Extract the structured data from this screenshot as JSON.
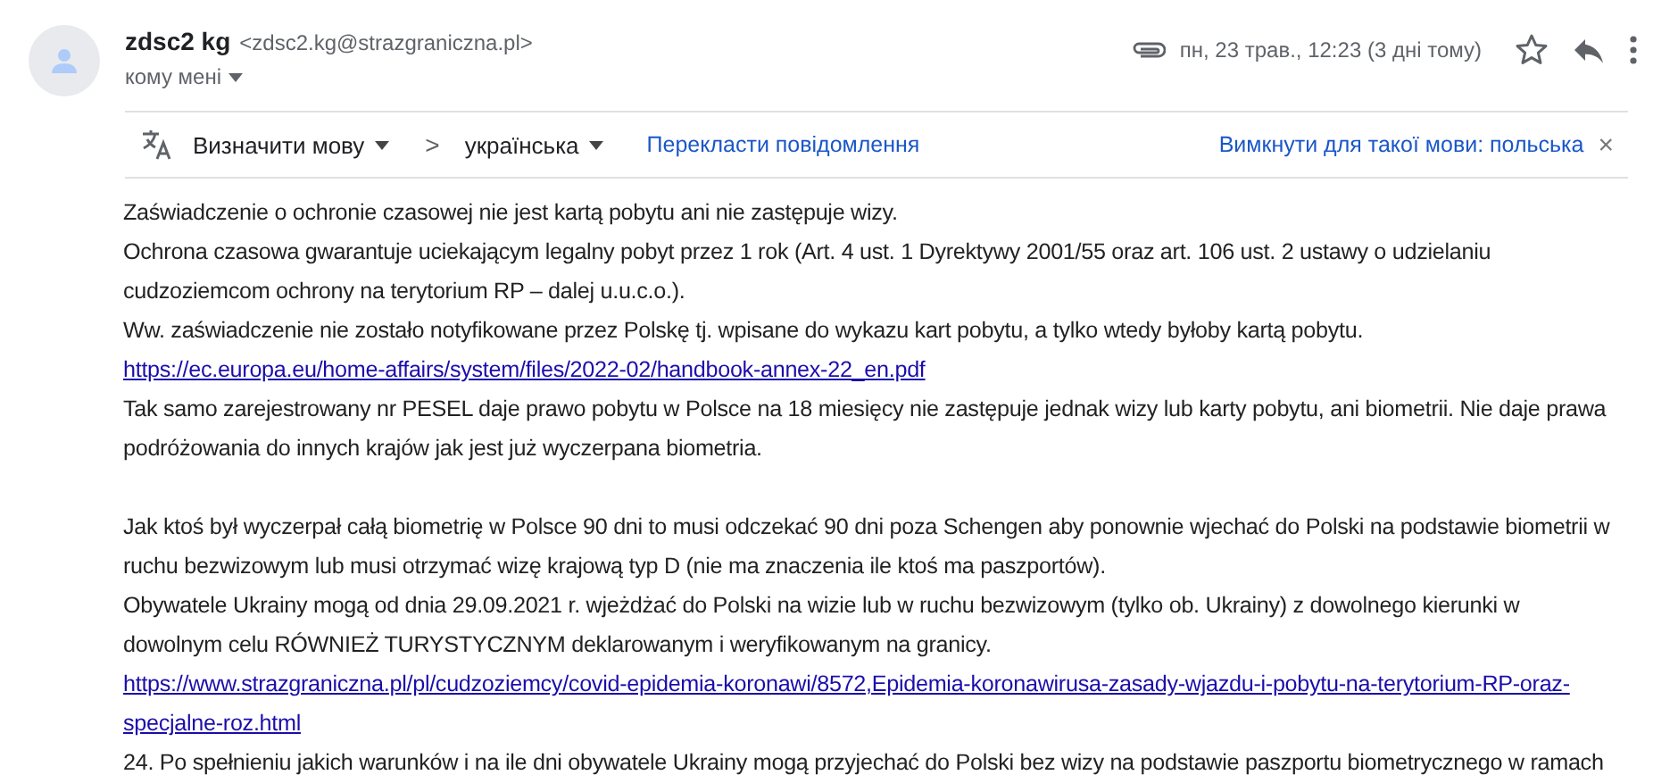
{
  "sender": {
    "name": "zdsc2 kg",
    "email": "<zdsc2.kg@strazgraniczna.pl>",
    "recipient": "кому мені"
  },
  "meta": {
    "date": "пн, 23 трав., 12:23 (3 дні тому)"
  },
  "translate_bar": {
    "source_language": "Визначити мову",
    "separator": ">",
    "target_language": "українська",
    "translate_link": "Перекласти повідомлення",
    "disable_link": "Вимкнути для такої мови: польська",
    "close": "×"
  },
  "body": [
    {
      "kind": "text",
      "text": "Zaświadczenie o ochronie czasowej nie jest kartą pobytu ani nie zastępuje wizy."
    },
    {
      "kind": "text",
      "text": "Ochrona czasowa gwarantuje uciekającym legalny pobyt przez 1 rok (Art. 4 ust. 1 Dyrektywy 2001/55 oraz art. 106 ust. 2 ustawy o udzielaniu"
    },
    {
      "kind": "text",
      "text": "cudzoziemcom ochrony na terytorium RP – dalej u.u.c.o.)."
    },
    {
      "kind": "text",
      "text": "Ww. zaświadczenie nie zostało notyfikowane przez Polskę tj. wpisane do wykazu kart pobytu, a tylko wtedy byłoby kartą pobytu."
    },
    {
      "kind": "link",
      "text": "https://ec.europa.eu/home-affairs/system/files/2022-02/handbook-annex-22_en.pdf"
    },
    {
      "kind": "text",
      "text": "Tak samo zarejestrowany nr PESEL daje prawo pobytu w Polsce na 18 miesięcy nie zastępuje jednak wizy lub karty pobytu, ani biometrii. Nie daje prawa"
    },
    {
      "kind": "text",
      "text": "podróżowania do innych krajów jak jest już wyczerpana biometria."
    },
    {
      "kind": "blank"
    },
    {
      "kind": "text",
      "text": "Jak ktoś był wyczerpał całą biometrię w Polsce 90 dni to musi odczekać 90 dni poza Schengen aby ponownie wjechać do Polski na podstawie biometrii w"
    },
    {
      "kind": "text",
      "text": "ruchu bezwizowym lub musi otrzymać wizę krajową typ D (nie ma znaczenia ile ktoś ma paszportów)."
    },
    {
      "kind": "text",
      "text": "Obywatele Ukrainy mogą od dnia 29.09.2021 r. wjeżdżać do Polski na wizie lub w ruchu bezwizowym (tylko ob. Ukrainy) z dowolnego kierunki w"
    },
    {
      "kind": "text",
      "text": "dowolnym celu RÓWNIEŻ TURYSTYCZNYM deklarowanym i weryfikowanym na granicy."
    },
    {
      "kind": "link",
      "text": "https://www.strazgraniczna.pl/pl/cudzoziemcy/covid-epidemia-koronawi/8572,Epidemia-koronawirusa-zasady-wjazdu-i-pobytu-na-terytorium-RP-oraz-"
    },
    {
      "kind": "link",
      "text": "specjalne-roz.html"
    },
    {
      "kind": "text",
      "text": "24. Po spełnieniu jakich warunków i na ile dni obywatele Ukrainy mogą przyjechać do Polski bez wizy na podstawie paszportu biometrycznego w ramach"
    }
  ]
}
